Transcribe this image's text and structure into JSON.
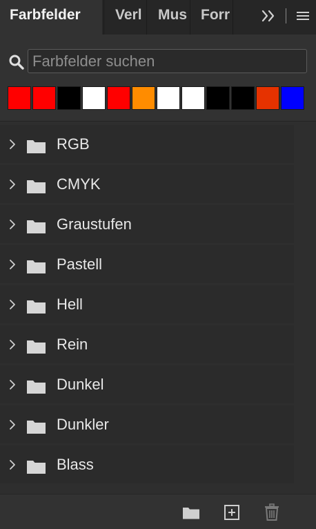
{
  "tabs": [
    {
      "label": "Farbfelder",
      "active": true
    },
    {
      "label": "Verl",
      "active": false
    },
    {
      "label": "Mus",
      "active": false
    },
    {
      "label": "Forr",
      "active": false
    }
  ],
  "tab_overflow_icon": "double-chevron-right-icon",
  "panel_menu_icon": "hamburger-menu-icon",
  "search": {
    "icon": "search-icon",
    "placeholder": "Farbfelder suchen",
    "value": ""
  },
  "recent_swatches": [
    "#ff0000",
    "#ff0000",
    "#000000",
    "#ffffff",
    "#ff0000",
    "#ff8c00",
    "#ffffff",
    "#ffffff",
    "#000000",
    "#000000",
    "#e63200",
    "#0000ff"
  ],
  "groups": [
    {
      "label": "RGB",
      "expanded": false
    },
    {
      "label": "CMYK",
      "expanded": false
    },
    {
      "label": "Graustufen",
      "expanded": false
    },
    {
      "label": "Pastell",
      "expanded": false
    },
    {
      "label": "Hell",
      "expanded": false
    },
    {
      "label": "Rein",
      "expanded": false
    },
    {
      "label": "Dunkel",
      "expanded": false
    },
    {
      "label": "Dunkler",
      "expanded": false
    },
    {
      "label": "Blass",
      "expanded": false
    }
  ],
  "footer": {
    "new_group_icon": "folder-icon",
    "new_swatch_icon": "add-square-icon",
    "delete_icon": "trash-icon"
  },
  "colors": {
    "panel_bg": "#323232",
    "tabbar_bg": "#262626",
    "row_bg": "#2b2b2b",
    "text": "#e8e8e8",
    "icon": "#d0d0d0"
  }
}
